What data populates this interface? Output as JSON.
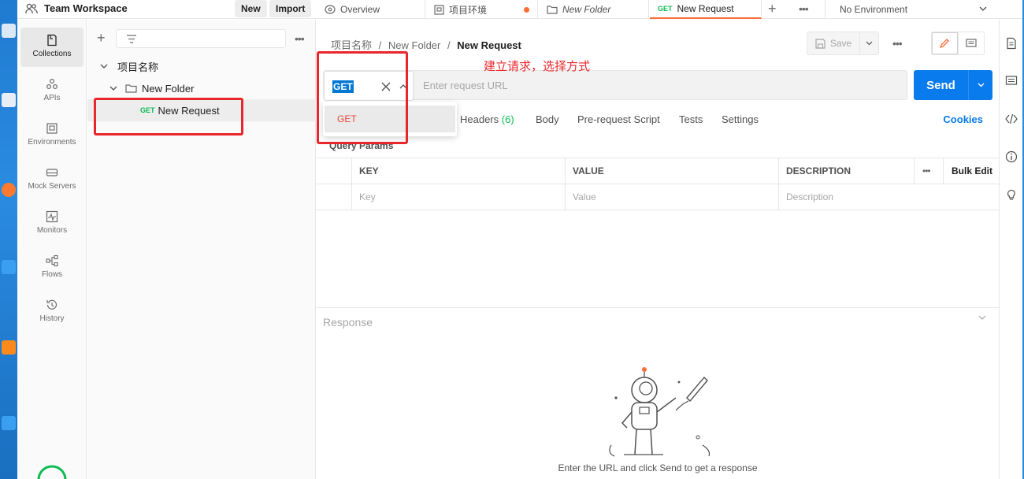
{
  "app": {
    "workspace_name": "Team Workspace",
    "new_label": "New",
    "import_label": "Import"
  },
  "tabs": [
    {
      "label": "Overview",
      "icon": "overview-icon"
    },
    {
      "label": "项目环境",
      "icon": "environment-icon",
      "unsaved": true
    },
    {
      "label": "New Folder",
      "icon": "folder-icon"
    },
    {
      "label": "New Request",
      "method": "GET",
      "active": true
    }
  ],
  "environment": {
    "selected": "No Environment"
  },
  "leftnav": [
    {
      "label": "Collections",
      "icon": "collections-icon",
      "active": true
    },
    {
      "label": "APIs",
      "icon": "apis-icon"
    },
    {
      "label": "Environments",
      "icon": "environments-icon"
    },
    {
      "label": "Mock Servers",
      "icon": "mock-servers-icon"
    },
    {
      "label": "Monitors",
      "icon": "monitors-icon"
    },
    {
      "label": "Flows",
      "icon": "flows-icon"
    },
    {
      "label": "History",
      "icon": "history-icon"
    }
  ],
  "sidebar": {
    "collection": "项目名称",
    "folder": "New Folder",
    "request": {
      "method": "GET",
      "name": "New Request"
    }
  },
  "breadcrumb": {
    "collection": "项目名称",
    "sep": "/",
    "folder": "New Folder",
    "request": "New Request"
  },
  "toolbar": {
    "save_label": "Save"
  },
  "request": {
    "method": "GET",
    "url_placeholder": "Enter request URL",
    "send_label": "Send",
    "method_options": [
      "GET"
    ]
  },
  "annotation": "建立请求，选择方式",
  "request_tabs": {
    "headers": "Headers",
    "headers_count": "(6)",
    "body": "Body",
    "pre_request": "Pre-request Script",
    "tests": "Tests",
    "settings": "Settings",
    "cookies": "Cookies",
    "query_params": "Query Params"
  },
  "params_table": {
    "headers": [
      "KEY",
      "VALUE",
      "DESCRIPTION"
    ],
    "bulk_edit": "Bulk Edit",
    "placeholders": [
      "Key",
      "Value",
      "Description"
    ]
  },
  "response": {
    "label": "Response",
    "empty_message": "Enter the URL and click Send to get a response"
  },
  "colors": {
    "accent": "#ff6c37",
    "send_blue": "#097bed",
    "get_green": "#0cbb52",
    "annotation_red": "#e8272b"
  }
}
